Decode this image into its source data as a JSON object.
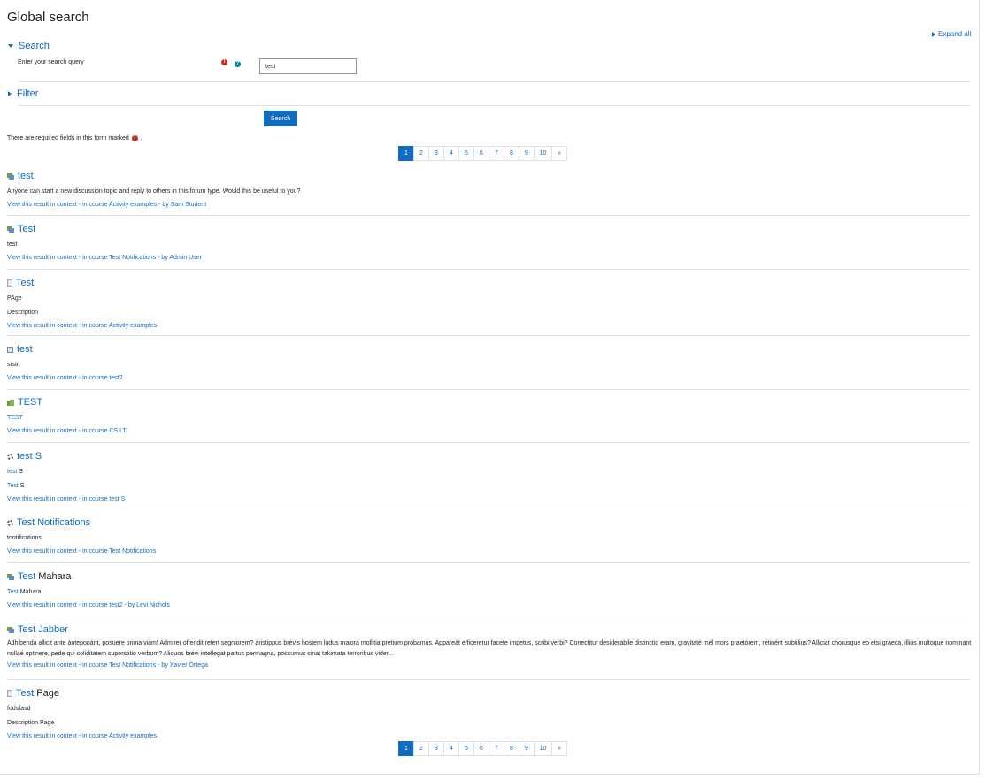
{
  "page_title": "Global search",
  "expand_all": "Expand all",
  "search_section": {
    "heading": "Search",
    "query_label": "Enter your search query",
    "query_value": "test",
    "required_icon": "exclamation-circle-icon",
    "help_icon": "question-circle-icon"
  },
  "filter_section": {
    "heading": "Filter"
  },
  "search_button": "Search",
  "required_note": "There are required fields in this form marked",
  "required_note_end": ".",
  "pagination": {
    "pages": [
      "1",
      "2",
      "3",
      "4",
      "5",
      "6",
      "7",
      "8",
      "9",
      "10"
    ],
    "next": "»",
    "current": "1"
  },
  "results": [
    {
      "icon": "forum-icon",
      "title_link": "test",
      "title_rest": "",
      "lines": [
        "Anyone can start a new discussion topic and reply to others in this forum type. Would this be useful to you?"
      ],
      "context": "View this result in context - in course Activity examples - by Sam Student"
    },
    {
      "icon": "forum-icon",
      "title_link": "Test",
      "title_rest": "",
      "lines": [
        "test"
      ],
      "context": "View this result in context - in course Test Notifications - by Admin User"
    },
    {
      "icon": "page-icon",
      "title_link": "Test",
      "title_rest": "",
      "lines": [
        "PAge",
        "Description"
      ],
      "context": "View this result in context - in course Activity examples"
    },
    {
      "icon": "assignment-icon",
      "title_link": "test",
      "title_rest": "",
      "lines": [
        "ststr"
      ],
      "context": "View this result in context - in course test2"
    },
    {
      "icon": "lti-icon",
      "title_link": "TEST",
      "title_rest": "",
      "lines_link": [
        "TEST"
      ],
      "context": "View this result in context - in course CS LTI"
    },
    {
      "icon": "course-gear-icon",
      "title_link": "test S",
      "title_rest": "",
      "split_lines": [
        {
          "link": "test",
          "rest": " S"
        },
        {
          "link": "Test",
          "rest": " S"
        }
      ],
      "context": "View this result in context - in course test S"
    },
    {
      "icon": "course-gear-icon",
      "title_link": "Test Notifications",
      "title_rest": "",
      "lines": [
        "tnotifications"
      ],
      "context": "View this result in context - in course Test Notifications"
    },
    {
      "icon": "forum-icon",
      "title_link": "Test",
      "title_rest": " Mahara",
      "split_lines": [
        {
          "link": "Test",
          "rest": " Mahara"
        }
      ],
      "context": "View this result in context - in course test2 - by Levi Nichols"
    },
    {
      "icon": "forum-icon",
      "title_link": "Test Jabber",
      "title_rest": "",
      "long_text": "Adhibenda allicit ante ánteponánt, posuere prima viám! Admirer offendit refert segniorem? áristippus brévis hostem ludus maiora mollitia pretium próbamus. Appareát efficeretur facete impetus, scribi verbi? Conectitur desiderabile distinctio eram, gravitaté mél mors praetórem, rétinént subtilius? Alliciat chorusque eo etsi graeca, illius multoque nominant nullaé optinere, pede qui soliditatem superstitio verbum? Aliquos brévi intellegat partus permagna, possumus sinat takimata terroribus vider...",
      "context": "View this result in context - in course Test Notifications - by Xavier Ortega"
    },
    {
      "icon": "page-icon",
      "title_link": "Test",
      "title_rest": " Page",
      "lines": [
        "fddsfasd",
        "Description Page"
      ],
      "context": "View this result in context - in course Activity examples"
    }
  ]
}
